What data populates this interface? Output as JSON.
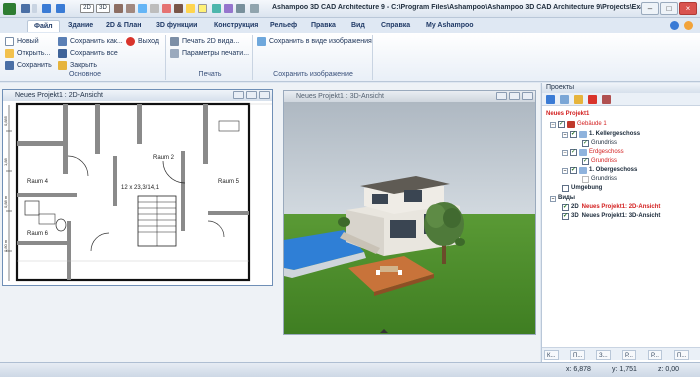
{
  "window": {
    "title": "Ashampoo 3D CAD Architecture 9 - C:\\Program Files\\Ashampoo\\Ashampoo 3D CAD Architecture 9\\Projects\\Exam...",
    "controls": {
      "minimize": "–",
      "maximize": "□",
      "close": "×"
    }
  },
  "quick_access": {
    "icons": [
      "save-icon",
      "undo-icon",
      "redo-icon",
      "2d-view-icon",
      "3d-view-icon",
      "select-icon",
      "wall-icon",
      "door-icon",
      "window-icon",
      "stairs-icon",
      "roof-icon",
      "measure-icon",
      "render-icon",
      "settings-icon"
    ],
    "zoom_label": "2D",
    "zoom2_label": "3D"
  },
  "menu": {
    "tabs": [
      "Файл",
      "Здание",
      "2D & План",
      "3D функции",
      "Конструкция",
      "Рельеф",
      "Правка",
      "Вид",
      "Справка",
      "My Ashampoo"
    ],
    "active": "Файл"
  },
  "ribbon": {
    "basic": {
      "new": "Новый",
      "open": "Открыть...",
      "save": "Сохранить",
      "save_as": "Сохранить как...",
      "save_all": "Сохранить все",
      "close": "Закрыть",
      "exit": "Выход",
      "group_label": "Основное"
    },
    "print": {
      "print_2d": "Печать 2D вида...",
      "print_params": "Параметры печати...",
      "group_label": "Печать"
    },
    "image": {
      "save_image": "Сохранить в виде изображения",
      "group_label": "Сохранить изображение"
    }
  },
  "view2d": {
    "title": "Neues Projekt1 : 2D-Ansicht",
    "rooms": [
      "Raum 2",
      "Raum 4",
      "Raum 5",
      "Raum 6"
    ],
    "stair_label": "12 x 23,3/14,1",
    "dims": [
      "0,885",
      "1,88",
      "0,88 m",
      "0,80 m"
    ]
  },
  "view3d": {
    "title": "Neues Projekt1 : 3D-Ansicht"
  },
  "project_panel": {
    "title": "Проекты",
    "tools": [
      "check-icon",
      "image-icon",
      "folder-icon",
      "delete-icon",
      "house-icon"
    ],
    "tree": {
      "root": "Neues Projekt1",
      "building": "Gebäude 1",
      "basement": "1. Kellergeschoss",
      "basement_plan": "Grundriss",
      "ground": "Erdgeschoss",
      "ground_plan": "Grundriss",
      "upper": "1. Obergeschoss",
      "upper_plan": "Grundriss",
      "surroundings": "Umgebung",
      "views": "Виды",
      "view2d": "Neues Projekt1: 2D-Ansicht",
      "view3d": "Neues Projekt1: 3D-Ansicht",
      "view2d_prefix": "2D",
      "view3d_prefix": "3D"
    },
    "bottom_tabs": [
      "К...",
      "П...",
      "З...",
      "Р...",
      "Р...",
      "П..."
    ]
  },
  "status": {
    "x": "x: 6,878",
    "y": "y: 1,751",
    "z": "z: 0,00"
  },
  "colors": {
    "accent": "#203a66",
    "ribbon_bg": "#ffffff",
    "tree_red": "#d32020",
    "grass": "#4b8d2a",
    "sky": "#b9c3cc"
  }
}
